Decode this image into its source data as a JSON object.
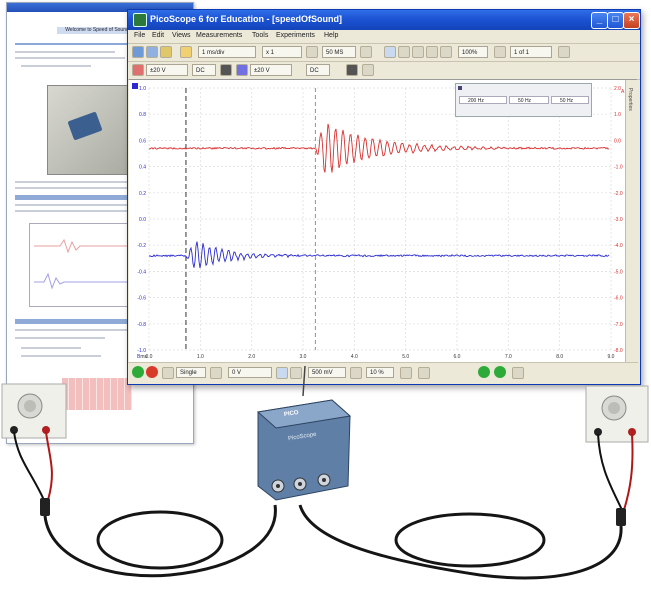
{
  "document": {
    "heading": "Welcome to Speed of Sound"
  },
  "window": {
    "title": "PicoScope 6 for Education - [speedOfSound]",
    "minimize": "_",
    "maximize": "□",
    "close": "×"
  },
  "menu": [
    "File",
    "Edit",
    "Views",
    "Measurements",
    "Tools",
    "Experiments",
    "Help"
  ],
  "toolbar": {
    "timebase": "1 ms/div",
    "zoom_x": "x 1",
    "samples": "50 MS",
    "zoom_pct": "100%",
    "buffer": "1 of 1"
  },
  "channels": {
    "a_range": "±20 V",
    "a_coupling": "DC",
    "b_range": "±20 V",
    "b_coupling": "DC"
  },
  "measurements": [
    "200 Hz",
    "50 Hz",
    "50 Hz"
  ],
  "sidebar_tab": "Properties",
  "scope": {
    "left_ticks": [
      "1.0",
      "0.8",
      "0.6",
      "0.4",
      "0.2",
      "0.0",
      "-0.2",
      "-0.4",
      "-0.6",
      "-0.8",
      "-1.0"
    ],
    "right_ticks": [
      "2.0",
      "1.0",
      "0.0",
      "-1.0",
      "-2.0",
      "-3.0",
      "-4.0",
      "-5.0",
      "-6.0",
      "-7.0",
      "-8.0"
    ],
    "x_ticks": [
      "0.0",
      "1.0",
      "2.0",
      "3.0",
      "4.0",
      "5.0",
      "6.0",
      "7.0",
      "8.0",
      "9.0"
    ],
    "x_unit": "ms",
    "channel_a_color": "#d93030",
    "channel_b_color": "#2a2ad0",
    "channel_a_tag": "A",
    "channel_b_tag": "B"
  },
  "status": {
    "trigger_mode": "Single",
    "trigger_level": "0 V",
    "pretrigger": "500 mV",
    "delay": "10 %"
  },
  "device": {
    "brand": "PICO",
    "model": "PicoScope"
  }
}
